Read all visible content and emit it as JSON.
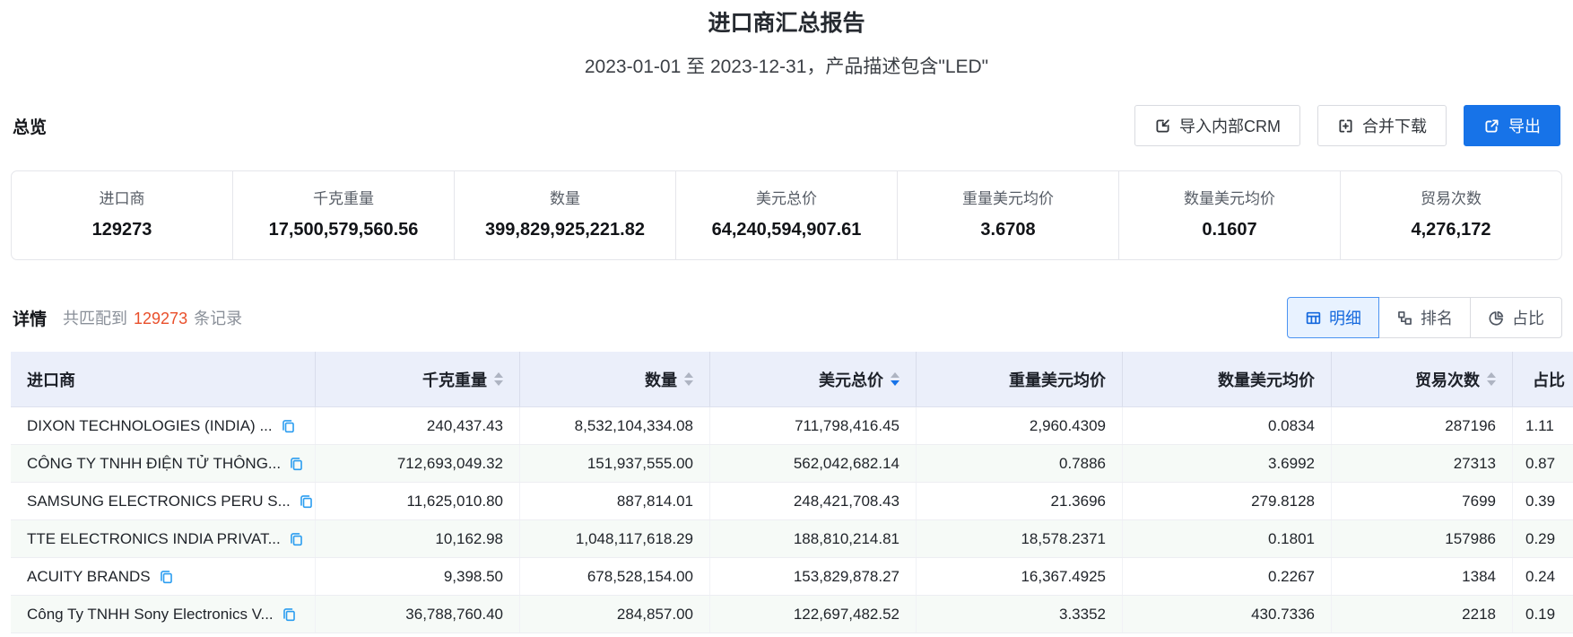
{
  "report": {
    "title": "进口商汇总报告",
    "subtitle": "2023-01-01 至 2023-12-31，产品描述包含\"LED\""
  },
  "toolbar": {
    "section_label": "总览",
    "import_crm_label": "导入内部CRM",
    "merge_download_label": "合并下载",
    "export_label": "导出"
  },
  "stats": [
    {
      "label": "进口商",
      "value": "129273"
    },
    {
      "label": "千克重量",
      "value": "17,500,579,560.56"
    },
    {
      "label": "数量",
      "value": "399,829,925,221.82"
    },
    {
      "label": "美元总价",
      "value": "64,240,594,907.61"
    },
    {
      "label": "重量美元均价",
      "value": "3.6708"
    },
    {
      "label": "数量美元均价",
      "value": "0.1607"
    },
    {
      "label": "贸易次数",
      "value": "4,276,172"
    }
  ],
  "details": {
    "label": "详情",
    "match_prefix": "共匹配到",
    "match_count": "129273",
    "match_suffix": "条记录",
    "tabs": [
      {
        "label": "明细",
        "active": true
      },
      {
        "label": "排名",
        "active": false
      },
      {
        "label": "占比",
        "active": false
      }
    ]
  },
  "table": {
    "columns": [
      {
        "label": "进口商",
        "sortable": false
      },
      {
        "label": "千克重量",
        "sortable": true,
        "sort": ""
      },
      {
        "label": "数量",
        "sortable": true,
        "sort": ""
      },
      {
        "label": "美元总价",
        "sortable": true,
        "sort": "desc"
      },
      {
        "label": "重量美元均价",
        "sortable": false
      },
      {
        "label": "数量美元均价",
        "sortable": false
      },
      {
        "label": "贸易次数",
        "sortable": true,
        "sort": ""
      },
      {
        "label": "占比",
        "sortable": false
      }
    ],
    "rows": [
      {
        "importer": "DIXON TECHNOLOGIES (INDIA) ...",
        "kg": "240,437.43",
        "qty": "8,532,104,334.08",
        "usd": "711,798,416.45",
        "kg_avg": "2,960.4309",
        "qty_avg": "0.0834",
        "trades": "287196",
        "share": "1.11"
      },
      {
        "importer": "CÔNG TY TNHH ĐIỆN TỬ THÔNG...",
        "kg": "712,693,049.32",
        "qty": "151,937,555.00",
        "usd": "562,042,682.14",
        "kg_avg": "0.7886",
        "qty_avg": "3.6992",
        "trades": "27313",
        "share": "0.87"
      },
      {
        "importer": "SAMSUNG ELECTRONICS PERU S...",
        "kg": "11,625,010.80",
        "qty": "887,814.01",
        "usd": "248,421,708.43",
        "kg_avg": "21.3696",
        "qty_avg": "279.8128",
        "trades": "7699",
        "share": "0.39"
      },
      {
        "importer": "TTE ELECTRONICS INDIA PRIVAT...",
        "kg": "10,162.98",
        "qty": "1,048,117,618.29",
        "usd": "188,810,214.81",
        "kg_avg": "18,578.2371",
        "qty_avg": "0.1801",
        "trades": "157986",
        "share": "0.29"
      },
      {
        "importer": "ACUITY BRANDS",
        "kg": "9,398.50",
        "qty": "678,528,154.00",
        "usd": "153,829,878.27",
        "kg_avg": "16,367.4925",
        "qty_avg": "0.2267",
        "trades": "1384",
        "share": "0.24"
      },
      {
        "importer": "Công Ty TNHH Sony Electronics V...",
        "kg": "36,788,760.40",
        "qty": "284,857.00",
        "usd": "122,697,482.52",
        "kg_avg": "3.3352",
        "qty_avg": "430.7336",
        "trades": "2218",
        "share": "0.19"
      }
    ]
  },
  "colors": {
    "primary": "#1773e8",
    "match_count_highlight": "#e94f2b",
    "table_header_bg": "#ebeffa",
    "active_tab_bg": "#e8f2ff",
    "copy_icon_blue": "#2b9df0"
  }
}
